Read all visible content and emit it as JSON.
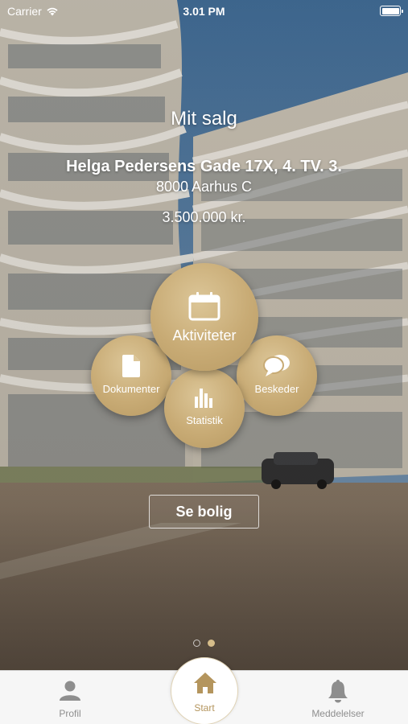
{
  "status_bar": {
    "carrier": "Carrier",
    "time": "3.01 PM"
  },
  "header": {
    "title": "Mit salg",
    "address": "Helga Pedersens Gade 17X, 4. TV. 3.",
    "city": "8000 Aarhus C",
    "price": "3.500.000 kr."
  },
  "menu": {
    "activities": {
      "label": "Aktiviteter",
      "icon": "calendar-icon"
    },
    "documents": {
      "label": "Dokumenter",
      "icon": "document-icon"
    },
    "statistics": {
      "label": "Statistik",
      "icon": "bar-chart-icon"
    },
    "messages": {
      "label": "Beskeder",
      "icon": "chat-bubbles-icon"
    }
  },
  "actions": {
    "see_property": "Se bolig"
  },
  "pager": {
    "pages": 2,
    "active_page": 2
  },
  "tabbar": {
    "profile": "Profil",
    "home": "Start",
    "notifications": "Meddelelser",
    "active": "Start"
  },
  "colors": {
    "accent": "#c8ab75",
    "active_tab": "#b4955d",
    "inactive_tab": "#8e8e8e"
  }
}
